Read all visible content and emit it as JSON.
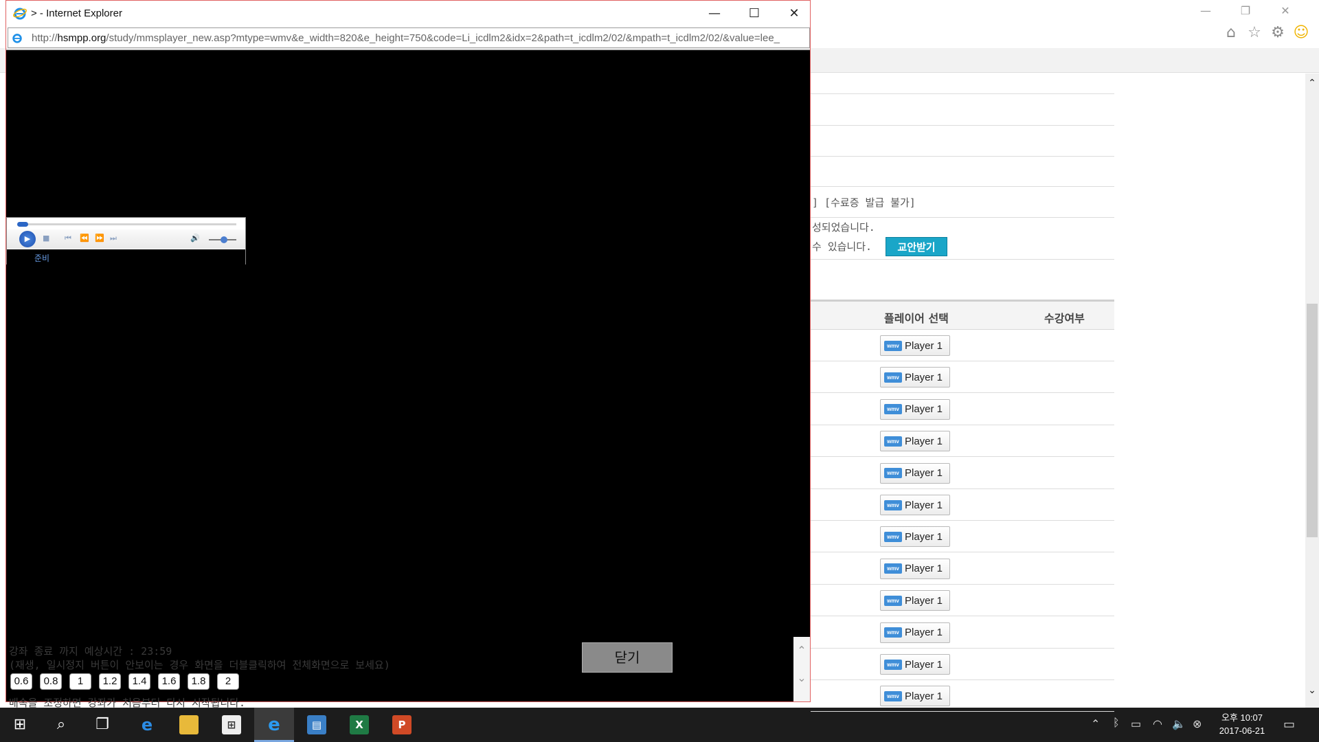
{
  "popup": {
    "title": "> - Internet Explorer",
    "url_prefix": "http://",
    "url_domain": "hsmpp.org",
    "url_rest": "/study/mmsplayer_new.asp?mtype=wmv&e_width=820&e_height=750&code=Li_icdlm2&idx=2&path=t_icdlm2/02/&mpath=t_icdlm2/02/&value=lee_",
    "minimize": "—",
    "maximize": "☐",
    "close": "✕"
  },
  "player": {
    "status": "준비"
  },
  "info": {
    "remaining": "강좌 종료 까지 예상시간 : 23:59",
    "hint": "(재생, 일시정지 버튼이 안보이는 경우 화면을 더블클릭하여 전체화면으로 보세요)",
    "speed_note": "배속을 조정하면 강좌가 처음부터 다시 시작됩니다.",
    "speeds": [
      "0.6",
      "0.8",
      "1",
      "1.2",
      "1.4",
      "1.6",
      "1.8",
      "2"
    ],
    "close_button": "닫기"
  },
  "background": {
    "cert_text": "] [수료증 발급 불가]",
    "line2": "성되었습니다.",
    "line3": "수 있습니다.",
    "download_button": "교안받기",
    "col_player": "플레이어 선택",
    "col_status": "수강여부",
    "player_badge": "wmv",
    "player_label": "Player 1"
  },
  "taskbar": {
    "clock_period": "오후 10:07",
    "clock_date": "2017-06-21",
    "apps": [
      "start",
      "search",
      "task-view",
      "edge",
      "file-explorer",
      "store",
      "internet-explorer",
      "reader",
      "excel",
      "powerpoint"
    ]
  },
  "colors": {
    "accent_download": "#1aa6c8",
    "wmv_badge": "#3f8ed8",
    "popup_border": "#e06060"
  }
}
